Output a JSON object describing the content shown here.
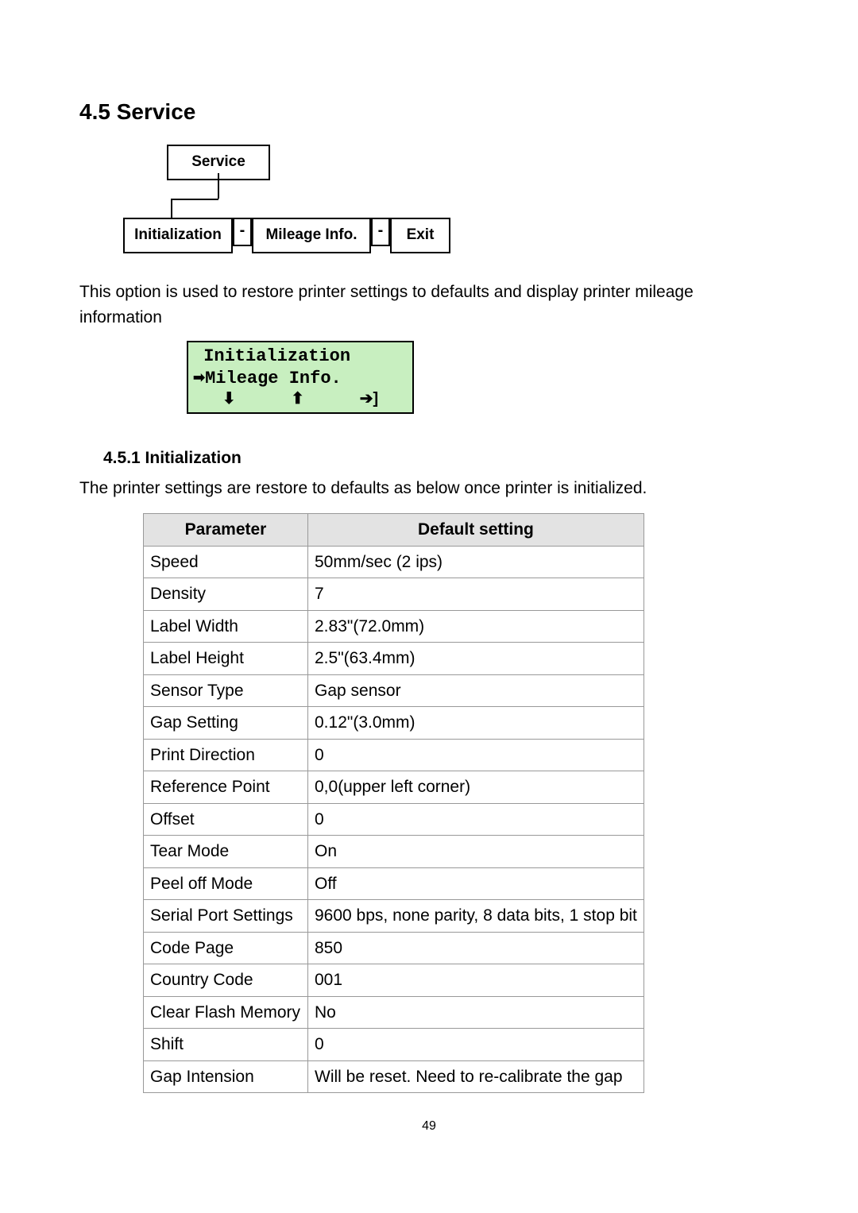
{
  "section": {
    "number_title": "4.5 Service"
  },
  "flowchart": {
    "root": "Service",
    "sep": "-",
    "items": [
      "Initialization",
      "Mileage Info.",
      "Exit"
    ]
  },
  "intro_para": "This option is used to restore printer settings to defaults and display printer mileage information",
  "lcd": {
    "line1": " Initialization",
    "line2_label": "Mileage Info.",
    "arrow_down": "⬇",
    "arrow_up": "⬆",
    "arrow_enter": "➔]"
  },
  "subsection": {
    "number_title": "4.5.1 Initialization",
    "para": "The printer settings are restore to defaults as below once printer is initialized."
  },
  "defaults_table": {
    "headers": [
      "Parameter",
      "Default setting"
    ],
    "rows": [
      [
        "Speed",
        "50mm/sec (2 ips)"
      ],
      [
        "Density",
        "7"
      ],
      [
        "Label Width",
        "2.83\"(72.0mm)"
      ],
      [
        "Label Height",
        "2.5\"(63.4mm)"
      ],
      [
        "Sensor Type",
        "Gap sensor"
      ],
      [
        "Gap Setting",
        "0.12\"(3.0mm)"
      ],
      [
        "Print Direction",
        "0"
      ],
      [
        "Reference Point",
        "0,0(upper left corner)"
      ],
      [
        "Offset",
        "0"
      ],
      [
        "Tear Mode",
        "On"
      ],
      [
        "Peel off Mode",
        "Off"
      ],
      [
        "Serial Port Settings",
        "9600 bps, none parity, 8 data bits, 1 stop bit"
      ],
      [
        "Code Page",
        "850"
      ],
      [
        "Country Code",
        "001"
      ],
      [
        "Clear Flash Memory",
        "No"
      ],
      [
        "Shift",
        "0"
      ],
      [
        "Gap Intension",
        "Will be reset. Need to re-calibrate the gap"
      ]
    ]
  },
  "page_number": "49"
}
